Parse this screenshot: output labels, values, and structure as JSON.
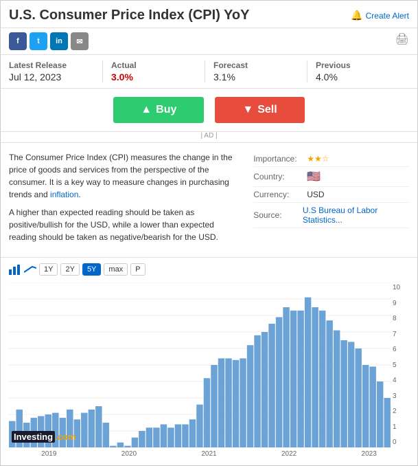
{
  "header": {
    "title": "U.S. Consumer Price Index (CPI) YoY",
    "create_alert": "Create Alert"
  },
  "social": {
    "buttons": [
      "f",
      "t",
      "in",
      "✉"
    ]
  },
  "stats": {
    "latest_release_label": "Latest Release",
    "latest_release_date": "Jul 12, 2023",
    "actual_label": "Actual",
    "actual_value": "3.0%",
    "forecast_label": "Forecast",
    "forecast_value": "3.1%",
    "previous_label": "Previous",
    "previous_value": "4.0%"
  },
  "trade": {
    "buy_label": "Buy",
    "sell_label": "Sell",
    "ad_label": "| AD |"
  },
  "description": {
    "text1": "The Consumer Price Index (CPI) measures the change in the price of goods and services from the perspective of the consumer. It is a key way to measure changes in purchasing trends and inflation.",
    "text2": "A higher than expected reading should be taken as positive/bullish for the USD, while a lower than expected reading should be taken as negative/bearish for the USD.",
    "link_text": "inflation"
  },
  "meta": {
    "importance_label": "Importance:",
    "importance_stars": "★★☆",
    "country_label": "Country:",
    "currency_label": "Currency:",
    "currency_value": "USD",
    "source_label": "Source:",
    "source_link": "U.S Bureau of Labor Statistics..."
  },
  "chart": {
    "time_buttons": [
      "1Y",
      "2Y",
      "5Y",
      "max"
    ],
    "p_button": "P",
    "y_labels": [
      "10",
      "9",
      "8",
      "7",
      "6",
      "5",
      "4",
      "3",
      "2",
      "1",
      "0"
    ],
    "x_labels": [
      "2019",
      "2020",
      "2021",
      "2022",
      "2023"
    ],
    "watermark": "Investing.com",
    "bars": [
      1.6,
      2.3,
      1.5,
      1.8,
      1.9,
      2.0,
      2.1,
      1.8,
      2.3,
      1.7,
      2.1,
      2.3,
      2.5,
      1.5,
      0.1,
      0.3,
      0.1,
      0.6,
      1.0,
      1.2,
      1.2,
      1.4,
      1.2,
      1.4,
      1.4,
      1.7,
      2.6,
      4.2,
      5.0,
      5.4,
      5.4,
      5.3,
      5.4,
      6.2,
      6.8,
      7.0,
      7.5,
      7.9,
      8.5,
      8.3,
      8.3,
      9.1,
      8.5,
      8.3,
      7.7,
      7.1,
      6.5,
      6.4,
      6.0,
      5.0,
      4.9,
      4.0,
      3.0
    ]
  }
}
